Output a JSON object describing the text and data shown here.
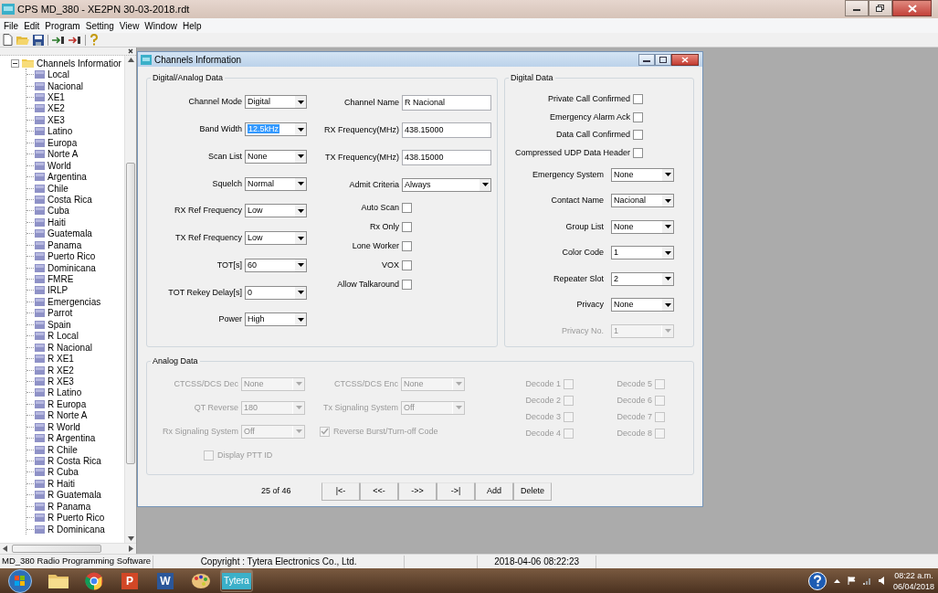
{
  "window": {
    "title": "CPS MD_380 - XE2PN 30-03-2018.rdt"
  },
  "menu": [
    "File",
    "Edit",
    "Program",
    "Setting",
    "View",
    "Window",
    "Help"
  ],
  "tree": {
    "label": "Channels Informatior",
    "expanded": true,
    "children": [
      {
        "label": "Local"
      },
      {
        "label": "Nacional"
      },
      {
        "label": "XE1"
      },
      {
        "label": "XE2"
      },
      {
        "label": "XE3"
      },
      {
        "label": "Latino"
      },
      {
        "label": "Europa"
      },
      {
        "label": "Norte A"
      },
      {
        "label": "World"
      },
      {
        "label": "Argentina"
      },
      {
        "label": "Chile"
      },
      {
        "label": "Costa Rica"
      },
      {
        "label": "Cuba"
      },
      {
        "label": "Haiti"
      },
      {
        "label": "Guatemala"
      },
      {
        "label": "Panama"
      },
      {
        "label": "Puerto Rico"
      },
      {
        "label": "Dominicana"
      },
      {
        "label": "FMRE"
      },
      {
        "label": "IRLP"
      },
      {
        "label": "Emergencias"
      },
      {
        "label": "Parrot"
      },
      {
        "label": "Spain"
      },
      {
        "label": "R Local"
      },
      {
        "label": "R Nacional"
      },
      {
        "label": "R XE1"
      },
      {
        "label": "R XE2"
      },
      {
        "label": "R XE3"
      },
      {
        "label": "R Latino"
      },
      {
        "label": "R Europa"
      },
      {
        "label": "R Norte A"
      },
      {
        "label": "R World"
      },
      {
        "label": "R Argentina"
      },
      {
        "label": "R Chile"
      },
      {
        "label": "R Costa Rica"
      },
      {
        "label": "R Cuba"
      },
      {
        "label": "R Haiti"
      },
      {
        "label": "R Guatemala"
      },
      {
        "label": "R Panama"
      },
      {
        "label": "R Puerto Rico"
      },
      {
        "label": "R Dominicana"
      }
    ]
  },
  "dialog": {
    "title": "Channels Information",
    "digital_analog": {
      "title": "Digital/Analog Data",
      "left": [
        {
          "label": "Channel Mode",
          "value": "Digital",
          "highlighted": false
        },
        {
          "label": "Band Width",
          "value": "12.5kHz",
          "highlighted": true
        },
        {
          "label": "Scan List",
          "value": "None",
          "highlighted": false
        },
        {
          "label": "Squelch",
          "value": "Normal",
          "highlighted": false
        },
        {
          "label": "RX Ref Frequency",
          "value": "Low",
          "highlighted": false
        },
        {
          "label": "TX Ref Frequency",
          "value": "Low",
          "highlighted": false
        },
        {
          "label": "TOT[s]",
          "value": "60",
          "highlighted": false
        },
        {
          "label": "TOT Rekey Delay[s]",
          "value": "0",
          "highlighted": false
        },
        {
          "label": "Power",
          "value": "High",
          "highlighted": false
        }
      ],
      "right": [
        {
          "kind": "text",
          "label": "Channel Name",
          "value": "R Nacional"
        },
        {
          "kind": "text",
          "label": "RX Frequency(MHz)",
          "value": "438.15000"
        },
        {
          "kind": "text",
          "label": "TX Frequency(MHz)",
          "value": "438.15000"
        },
        {
          "kind": "combo",
          "label": "Admit Criteria",
          "value": "Always"
        },
        {
          "kind": "check",
          "label": "Auto Scan",
          "checked": false
        },
        {
          "kind": "check",
          "label": "Rx Only",
          "checked": false
        },
        {
          "kind": "check",
          "label": "Lone Worker",
          "checked": false
        },
        {
          "kind": "check",
          "label": "VOX",
          "checked": false
        },
        {
          "kind": "check",
          "label": "Allow Talkaround",
          "checked": false
        }
      ]
    },
    "digital": {
      "title": "Digital Data",
      "checks": [
        {
          "label": "Private Call Confirmed",
          "checked": false
        },
        {
          "label": "Emergency Alarm Ack",
          "checked": false
        },
        {
          "label": "Data Call Confirmed",
          "checked": false
        },
        {
          "label": "Compressed UDP Data Header",
          "checked": false
        }
      ],
      "combos": [
        {
          "label": "Emergency System",
          "value": "None",
          "disabled": false
        },
        {
          "label": "Contact Name",
          "value": "Nacional",
          "disabled": false
        },
        {
          "label": "Group List",
          "value": "None",
          "disabled": false
        },
        {
          "label": "Color Code",
          "value": "1",
          "disabled": false
        },
        {
          "label": "Repeater Slot",
          "value": "2",
          "disabled": false
        },
        {
          "label": "Privacy",
          "value": "None",
          "disabled": false
        },
        {
          "label": "Privacy No.",
          "value": "1",
          "disabled": true
        }
      ]
    },
    "analog": {
      "title": "Analog Data",
      "disabled": true,
      "combos": [
        {
          "label": "CTCSS/DCS Dec",
          "value": "None"
        },
        {
          "label": "CTCSS/DCS Enc",
          "value": "None"
        },
        {
          "label": "QT Reverse",
          "value": "180"
        },
        {
          "label": "Tx Signaling System",
          "value": "Off"
        },
        {
          "label": "Rx Signaling System",
          "value": "Off"
        }
      ],
      "checks": [
        {
          "label": "Reverse Burst/Turn-off Code",
          "checked": true
        },
        {
          "label": "Display PTT ID",
          "checked": false
        }
      ],
      "decodes": [
        {
          "label": "Decode 1",
          "checked": false
        },
        {
          "label": "Decode 2",
          "checked": false
        },
        {
          "label": "Decode 3",
          "checked": false
        },
        {
          "label": "Decode 4",
          "checked": false
        },
        {
          "label": "Decode 5",
          "checked": false
        },
        {
          "label": "Decode 6",
          "checked": false
        },
        {
          "label": "Decode 7",
          "checked": false
        },
        {
          "label": "Decode 8",
          "checked": false
        }
      ]
    },
    "nav": {
      "position": "25 of 46",
      "buttons": [
        "|<-",
        "<<-",
        "->>",
        "->|",
        "Add",
        "Delete"
      ]
    }
  },
  "status_bar": [
    "MD_380 Radio Programming Software",
    "Copyright : Tytera Electronics Co., Ltd.",
    "2018-04-06 08:22:23"
  ],
  "taskbar": {
    "apps": [
      {
        "kind": "start"
      },
      {
        "kind": "explorer"
      },
      {
        "kind": "chrome"
      },
      {
        "kind": "slides",
        "glyph": "P"
      },
      {
        "kind": "word",
        "glyph": "W"
      },
      {
        "kind": "paint"
      },
      {
        "kind": "app",
        "label": "Tytera"
      }
    ],
    "clock": {
      "time": "08:22 a.m.",
      "date": "06/04/2018"
    }
  }
}
